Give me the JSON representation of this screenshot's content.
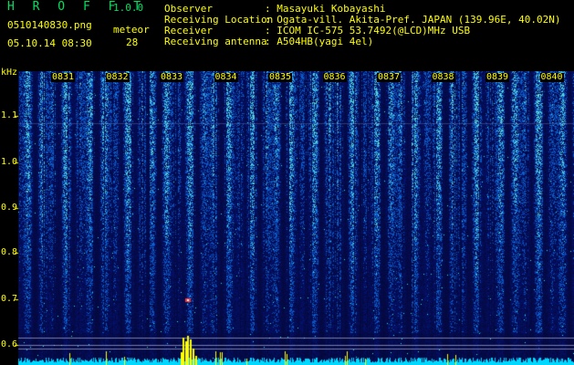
{
  "app": {
    "name": "H R O F F T",
    "version": "1.0.0",
    "file_name": "0510140830.png",
    "timestamp": "05.10.14 08:30",
    "meteor_label": "meteor",
    "meteor_count": "28"
  },
  "info": {
    "observer_label": "Observer",
    "observer_value": ": Masayuki Kobayashi",
    "location_label": "Receiving Location",
    "location_value": ": Ogata-vill. Akita-Pref. JAPAN (139.96E, 40.02N)",
    "receiver_label": "Receiver",
    "receiver_value": ": ICOM IC-575 53.7492(@LCD)MHz USB",
    "antenna_label": "Receiving antenna",
    "antenna_value": ": A504HB(yagi 4el)"
  },
  "spectrogram": {
    "unit_label": "kHz",
    "freq_ticks": [
      "1.1",
      "1.0",
      "0.9",
      "0.8",
      "0.7",
      "0.6"
    ],
    "time_ticks": [
      "0831",
      "0832",
      "0833",
      "0834",
      "0835",
      "0836",
      "0837",
      "0838",
      "0839",
      "0840"
    ],
    "colors": {
      "background": "#000000",
      "label": "#ffff00",
      "noise_low": "#0a1a6e",
      "noise_high": "#2a8cff",
      "meteor": "#ff3030",
      "baseline": "#00e0ff"
    }
  }
}
